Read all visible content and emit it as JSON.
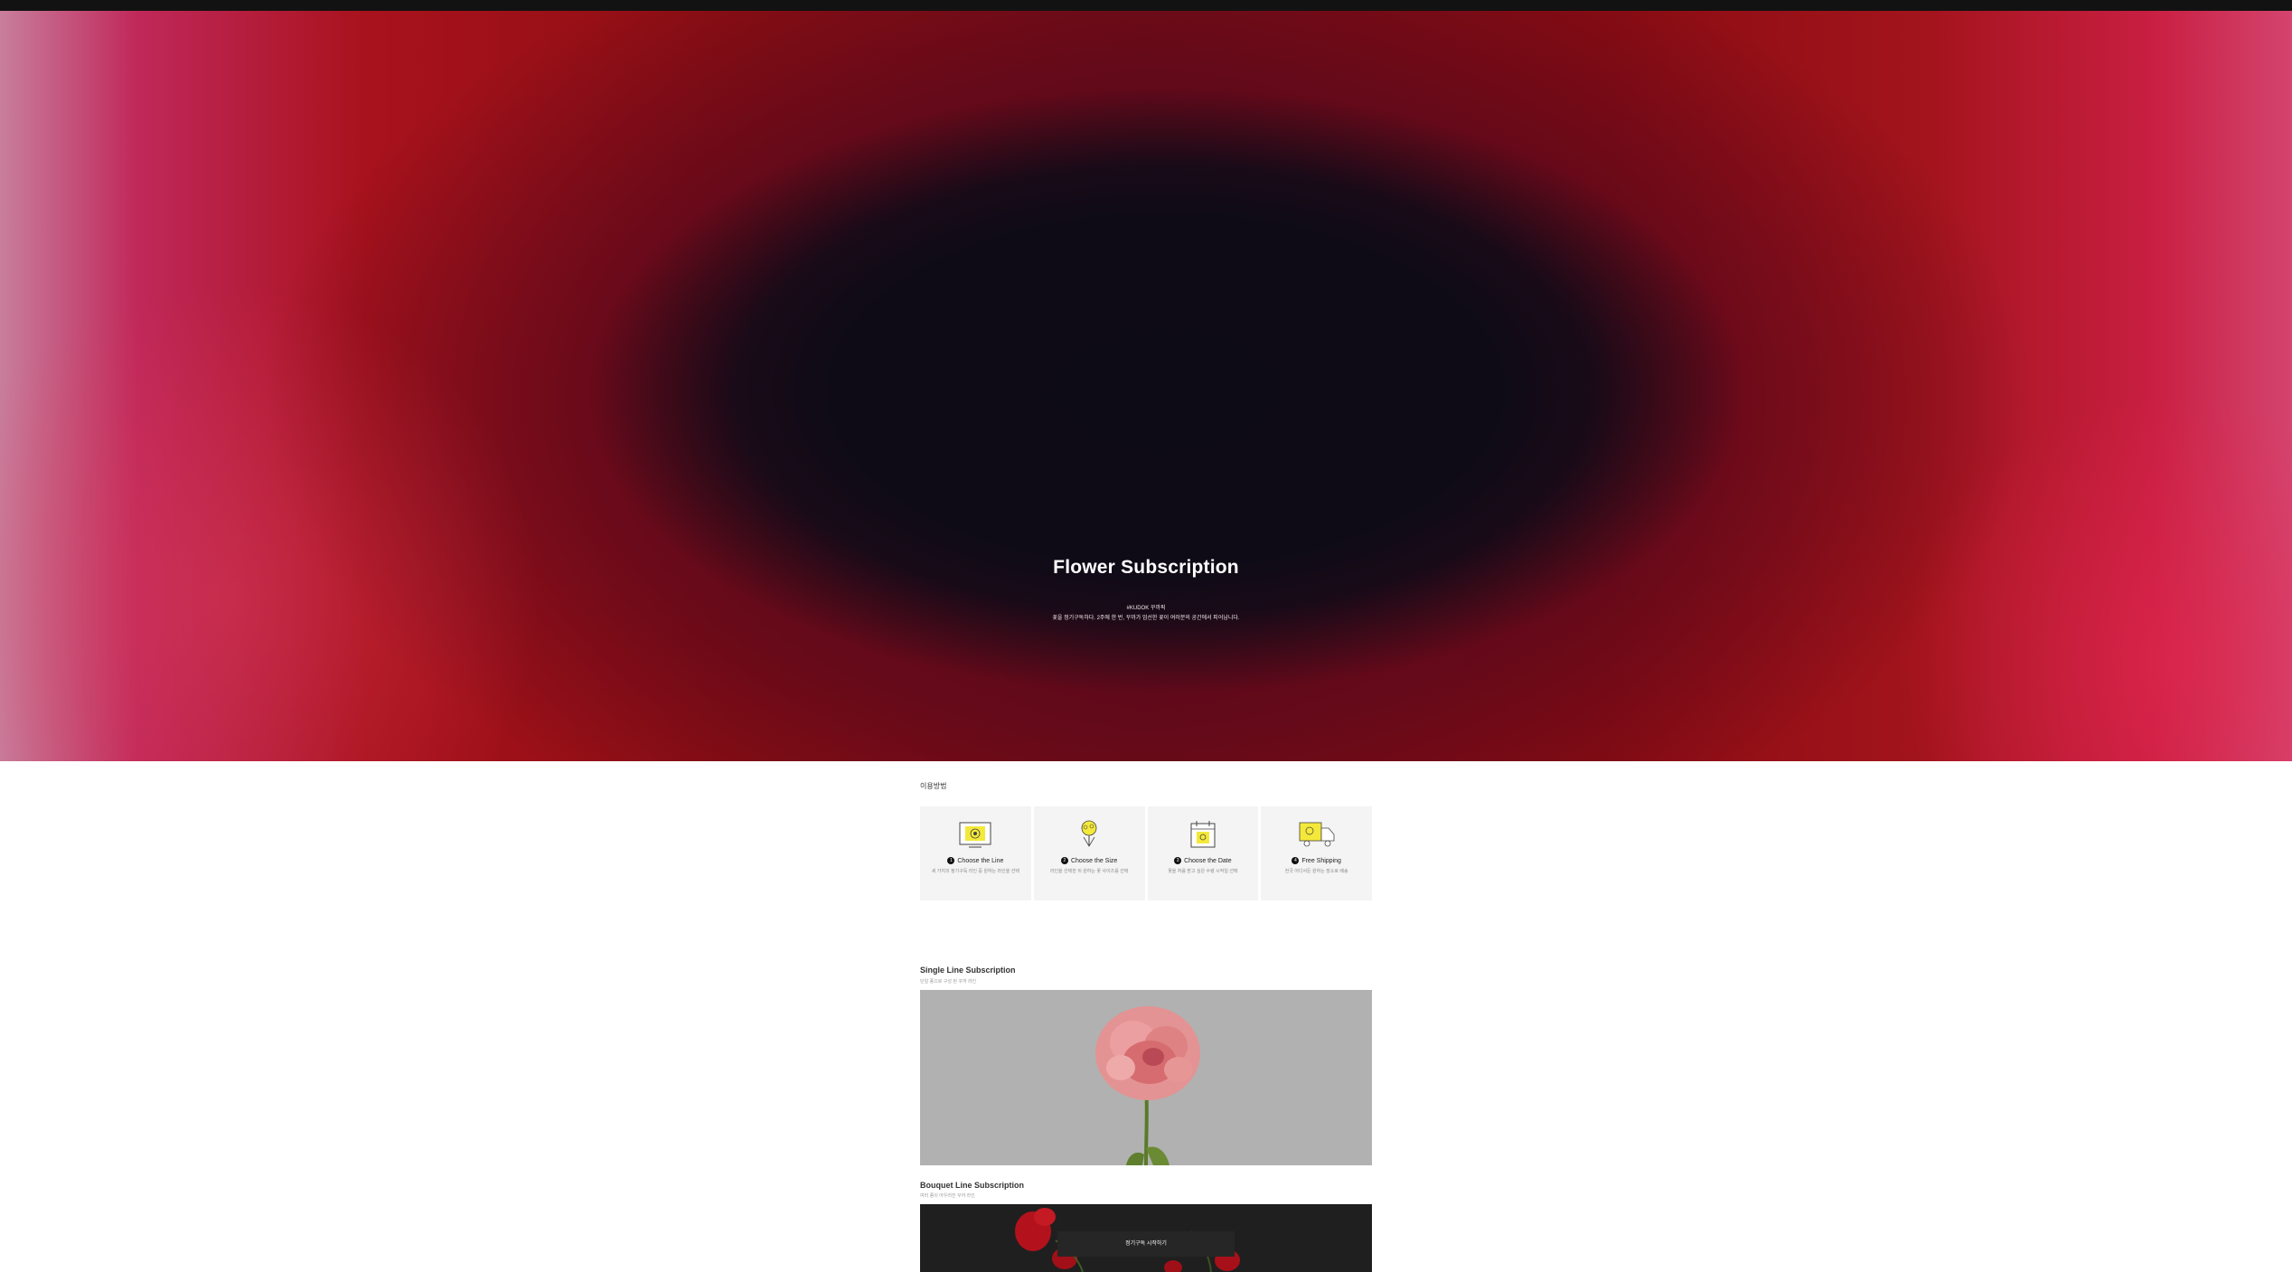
{
  "hero": {
    "title": "Flower Subscription",
    "subtitle_line1": "#KUDOK 꾸까픽",
    "subtitle_line2": "꽃을 정기구독하다. 2주에 한 번, 꾸까가 엄선한 꽃이 여러분의 공간에서 피어납니다."
  },
  "how_to": {
    "label": "이용방법",
    "steps": [
      {
        "num": "1",
        "title": "Choose the Line",
        "desc": "세 가지의 정기구독 라인 중 원하는 라인을 선택",
        "icon": "box-flower-icon"
      },
      {
        "num": "2",
        "title": "Choose the Size",
        "desc": "라인을 선택한 뒤 원하는 꽃 사이즈를 선택",
        "icon": "bouquet-icon"
      },
      {
        "num": "3",
        "title": "Choose the Date",
        "desc": "꽃을 처음 받고 싶은 수령 시작일 선택",
        "icon": "calendar-icon"
      },
      {
        "num": "4",
        "title": "Free Shipping",
        "desc": "전국 어디서든 원하는 장소로 배송",
        "icon": "truck-icon"
      }
    ]
  },
  "single_line": {
    "title": "Single Line Subscription",
    "subtitle": "단일 종으로 구성 된 꾸까 라인"
  },
  "bouquet_line": {
    "title": "Bouquet Line Subscription",
    "subtitle": "여러 종이 어우러진 꾸까 라인",
    "cta_label": "정기구독 시작하기"
  },
  "colors": {
    "accent_yellow": "#f4e93a",
    "hero_dark": "#0e0b17",
    "hero_red": "#8e0e12"
  }
}
